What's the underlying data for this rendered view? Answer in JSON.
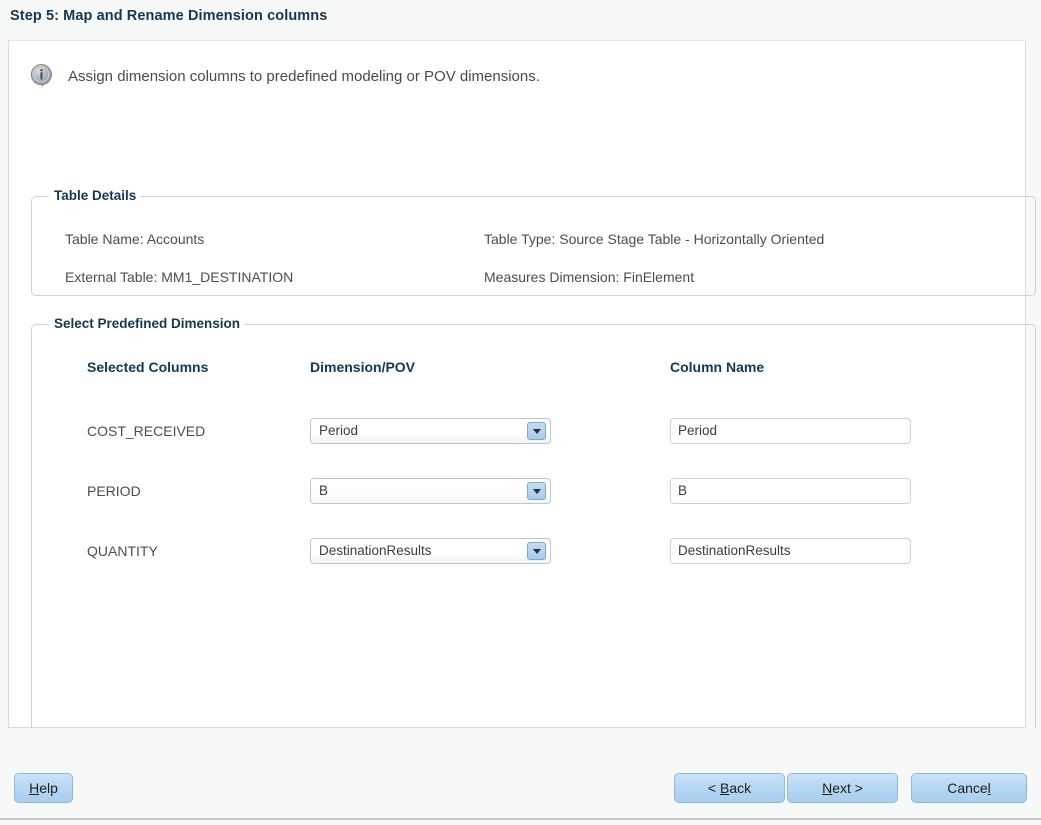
{
  "window": {
    "step_title": "Step 5: Map and Rename Dimension columns"
  },
  "instruction": {
    "icon": "info-icon",
    "text": "Assign dimension columns to predefined modeling or POV dimensions."
  },
  "table_details": {
    "legend": "Table Details",
    "fields": [
      {
        "label": "Table Name: Accounts"
      },
      {
        "label": "Table Type: Source Stage Table - Horizontally Oriented"
      },
      {
        "label": "External Table: MM1_DESTINATION"
      },
      {
        "label": "Measures Dimension: FinElement"
      }
    ]
  },
  "select_predefined_dimension": {
    "legend": "Select Predefined Dimension",
    "columns": {
      "selected_columns": "Selected Columns",
      "dimension_pov": "Dimension/POV",
      "column_name": "Column Name"
    },
    "rows": [
      {
        "selected_column": "COST_RECEIVED",
        "dimension_pov": "Period",
        "column_name": "Period",
        "dropdown_icon": "chevron-down-icon"
      },
      {
        "selected_column": "PERIOD",
        "dimension_pov": "B",
        "column_name": "B",
        "dropdown_icon": "chevron-down-icon"
      },
      {
        "selected_column": "QUANTITY",
        "dimension_pov": "DestinationResults",
        "column_name": "DestinationResults",
        "dropdown_icon": "chevron-down-icon"
      }
    ]
  },
  "buttons": {
    "help": {
      "prefix": "",
      "mnemonic": "H",
      "suffix": "elp"
    },
    "back": {
      "prefix": "< ",
      "mnemonic": "B",
      "suffix": "ack"
    },
    "next": {
      "prefix": "",
      "mnemonic": "N",
      "suffix": "ext >"
    },
    "cancel": {
      "prefix": "Cance",
      "mnemonic": "l",
      "suffix": ""
    }
  },
  "colors": {
    "title_blue": "#16374f",
    "panel_bg": "#ffffff",
    "window_bg": "#f7f8f8",
    "button_blue": "#b5d7f2",
    "dropdown_blue": "#a8cbec"
  }
}
